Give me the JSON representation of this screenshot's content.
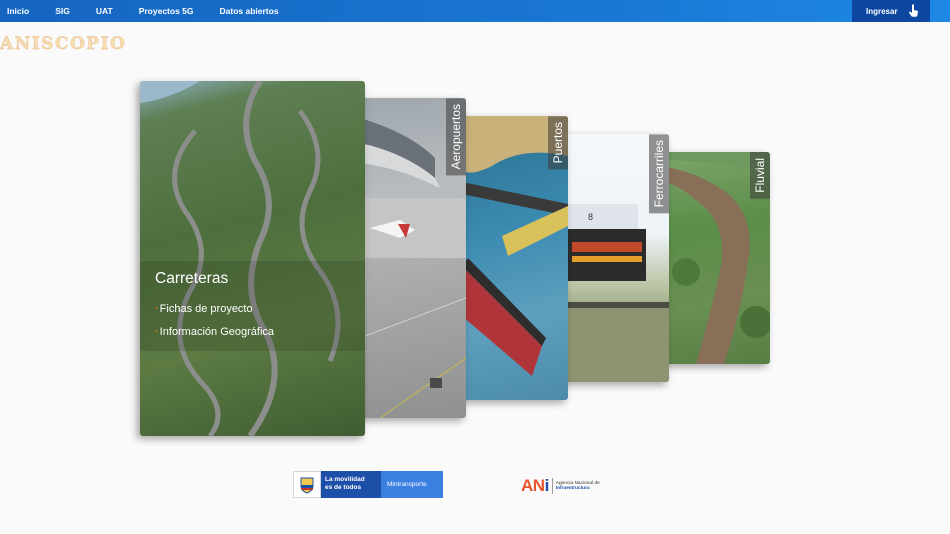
{
  "nav": {
    "items": [
      "Inicio",
      "SIG",
      "UAT",
      "Proyectos 5G",
      "Datos abiertos"
    ],
    "login_label": "Ingresar"
  },
  "brand": {
    "text": "ANISCOPIO"
  },
  "cards": {
    "carreteras": {
      "title": "Carreteras",
      "links": [
        "Fichas de proyecto",
        "Información Geográfica"
      ]
    },
    "aeropuertos": {
      "label": "Aeropuertos"
    },
    "puertos": {
      "label": "Puertos"
    },
    "ferrocarriles": {
      "label": "Ferrocarriles"
    },
    "fluvial": {
      "label": "Fluvial"
    }
  },
  "footer": {
    "mintransporte": {
      "slogan_line1": "La movilidad",
      "slogan_line2": "es de todos",
      "name": "Mintransporte"
    },
    "ani": {
      "mark_a": "AN",
      "mark_i": "i",
      "text_line1": "Agencia Nacional de",
      "text_line2": "Infraestructura"
    }
  },
  "colors": {
    "nav_bg": "#1976d2",
    "login_bg": "#0d47a1",
    "accent_orange": "#e9751e"
  }
}
